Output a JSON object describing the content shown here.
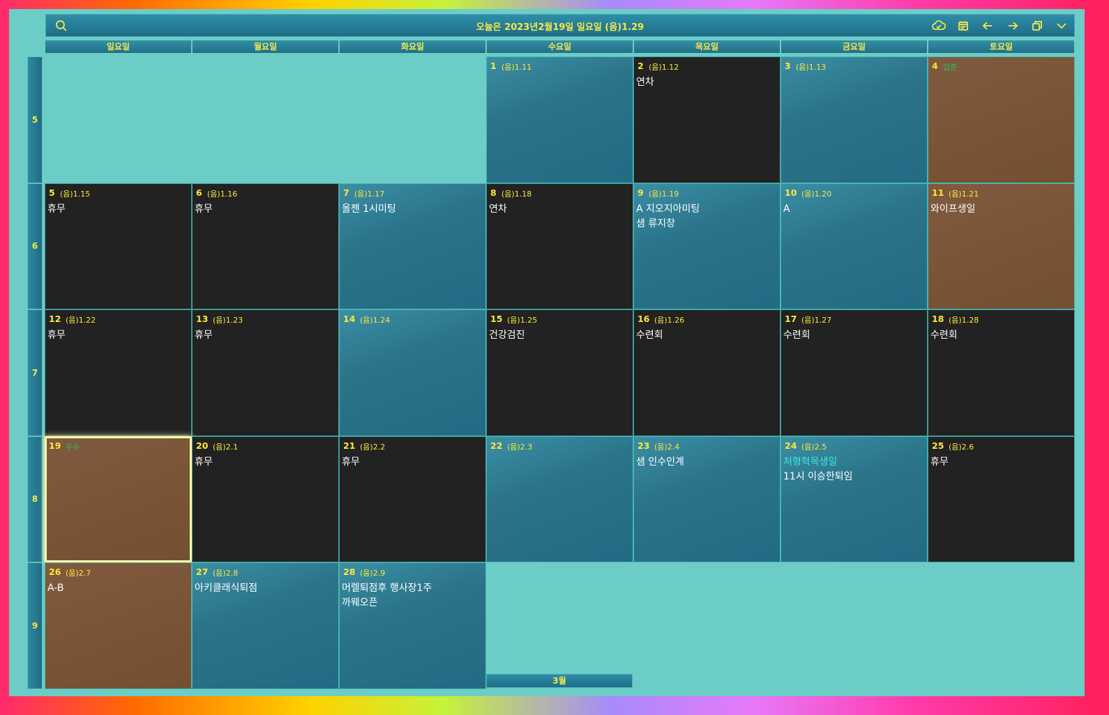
{
  "header": {
    "title": "오늘은 2023년2월19일 일요일 (음)1.29",
    "icons": [
      "search-icon",
      "sync-icon",
      "calendar-icon",
      "arrow-left-icon",
      "arrow-right-icon",
      "restore-window-icon",
      "chevron-down-icon"
    ]
  },
  "weekdays": [
    "일요일",
    "월요일",
    "화요일",
    "수요일",
    "목요일",
    "금요일",
    "토요일"
  ],
  "week_numbers": [
    "5",
    "6",
    "7",
    "8",
    "9"
  ],
  "colors": {
    "accent_yellow": "#f5e94b",
    "cell_blue": "#2a7389",
    "cell_dark": "#222222",
    "cell_brown": "#73502f",
    "background": "#6ccdc6",
    "solar_term_green": "#28c060",
    "event_cyan": "#3ee6e0"
  },
  "days": [
    {
      "week": 0,
      "dow": 3,
      "day": "1",
      "lunar": "(음)1.11",
      "style": "blue",
      "events": []
    },
    {
      "week": 0,
      "dow": 4,
      "day": "2",
      "lunar": "(음)1.12",
      "style": "dark",
      "events": [
        "연차"
      ]
    },
    {
      "week": 0,
      "dow": 5,
      "day": "3",
      "lunar": "(음)1.13",
      "style": "blue",
      "events": []
    },
    {
      "week": 0,
      "dow": 6,
      "day": "4",
      "lunar": "입춘",
      "lunar_term": true,
      "style": "brown",
      "events": []
    },
    {
      "week": 1,
      "dow": 0,
      "day": "5",
      "lunar": "(음)1.15",
      "style": "dark",
      "events": [
        "휴무"
      ]
    },
    {
      "week": 1,
      "dow": 1,
      "day": "6",
      "lunar": "(음)1.16",
      "style": "dark",
      "events": [
        "휴무"
      ]
    },
    {
      "week": 1,
      "dow": 2,
      "day": "7",
      "lunar": "(음)1.17",
      "style": "blue",
      "events": [
        "올젠 1시미팅"
      ]
    },
    {
      "week": 1,
      "dow": 3,
      "day": "8",
      "lunar": "(음)1.18",
      "style": "dark",
      "events": [
        "연차"
      ]
    },
    {
      "week": 1,
      "dow": 4,
      "day": "9",
      "lunar": "(음)1.19",
      "style": "blue",
      "events": [
        "A 지오지아미팅",
        "샘 류지창"
      ]
    },
    {
      "week": 1,
      "dow": 5,
      "day": "10",
      "lunar": "(음)1.20",
      "style": "blue",
      "events": [
        "A"
      ]
    },
    {
      "week": 1,
      "dow": 6,
      "day": "11",
      "lunar": "(음)1.21",
      "style": "brown",
      "events": [
        "와이프생일"
      ]
    },
    {
      "week": 2,
      "dow": 0,
      "day": "12",
      "lunar": "(음)1.22",
      "style": "dark",
      "events": [
        "휴무"
      ]
    },
    {
      "week": 2,
      "dow": 1,
      "day": "13",
      "lunar": "(음)1.23",
      "style": "dark",
      "events": [
        "휴무"
      ]
    },
    {
      "week": 2,
      "dow": 2,
      "day": "14",
      "lunar": "(음)1.24",
      "style": "blue",
      "events": []
    },
    {
      "week": 2,
      "dow": 3,
      "day": "15",
      "lunar": "(음)1.25",
      "style": "dark",
      "events": [
        "건강검진"
      ]
    },
    {
      "week": 2,
      "dow": 4,
      "day": "16",
      "lunar": "(음)1.26",
      "style": "dark",
      "events": [
        "수련회"
      ]
    },
    {
      "week": 2,
      "dow": 5,
      "day": "17",
      "lunar": "(음)1.27",
      "style": "dark",
      "events": [
        "수련회"
      ]
    },
    {
      "week": 2,
      "dow": 6,
      "day": "18",
      "lunar": "(음)1.28",
      "style": "dark",
      "events": [
        "수련회"
      ]
    },
    {
      "week": 3,
      "dow": 0,
      "day": "19",
      "lunar": "우수",
      "lunar_term": true,
      "style": "brown",
      "today": true,
      "events": []
    },
    {
      "week": 3,
      "dow": 1,
      "day": "20",
      "lunar": "(음)2.1",
      "style": "dark",
      "events": [
        "휴무"
      ]
    },
    {
      "week": 3,
      "dow": 2,
      "day": "21",
      "lunar": "(음)2.2",
      "style": "dark",
      "events": [
        "휴무"
      ]
    },
    {
      "week": 3,
      "dow": 3,
      "day": "22",
      "lunar": "(음)2.3",
      "style": "blue",
      "events": []
    },
    {
      "week": 3,
      "dow": 4,
      "day": "23",
      "lunar": "(음)2.4",
      "style": "blue",
      "events": [
        "샘 인수인계"
      ]
    },
    {
      "week": 3,
      "dow": 5,
      "day": "24",
      "lunar": "(음)2.5",
      "style": "blue",
      "events": [
        "처형혁목생일",
        "11시 이승한퇴임"
      ],
      "cyan_first": true
    },
    {
      "week": 3,
      "dow": 6,
      "day": "25",
      "lunar": "(음)2.6",
      "style": "dark",
      "events": [
        "휴무"
      ]
    },
    {
      "week": 4,
      "dow": 0,
      "day": "26",
      "lunar": "(음)2.7",
      "style": "brown",
      "events": [
        "A-B"
      ]
    },
    {
      "week": 4,
      "dow": 1,
      "day": "27",
      "lunar": "(음)2.8",
      "style": "blue",
      "events": [
        "아키클래식퇴점"
      ]
    },
    {
      "week": 4,
      "dow": 2,
      "day": "28",
      "lunar": "(음)2.9",
      "style": "blue",
      "events": [
        "머렐퇴점후 행사장1주",
        "까웨오픈"
      ]
    }
  ],
  "next_month_label": "3월"
}
